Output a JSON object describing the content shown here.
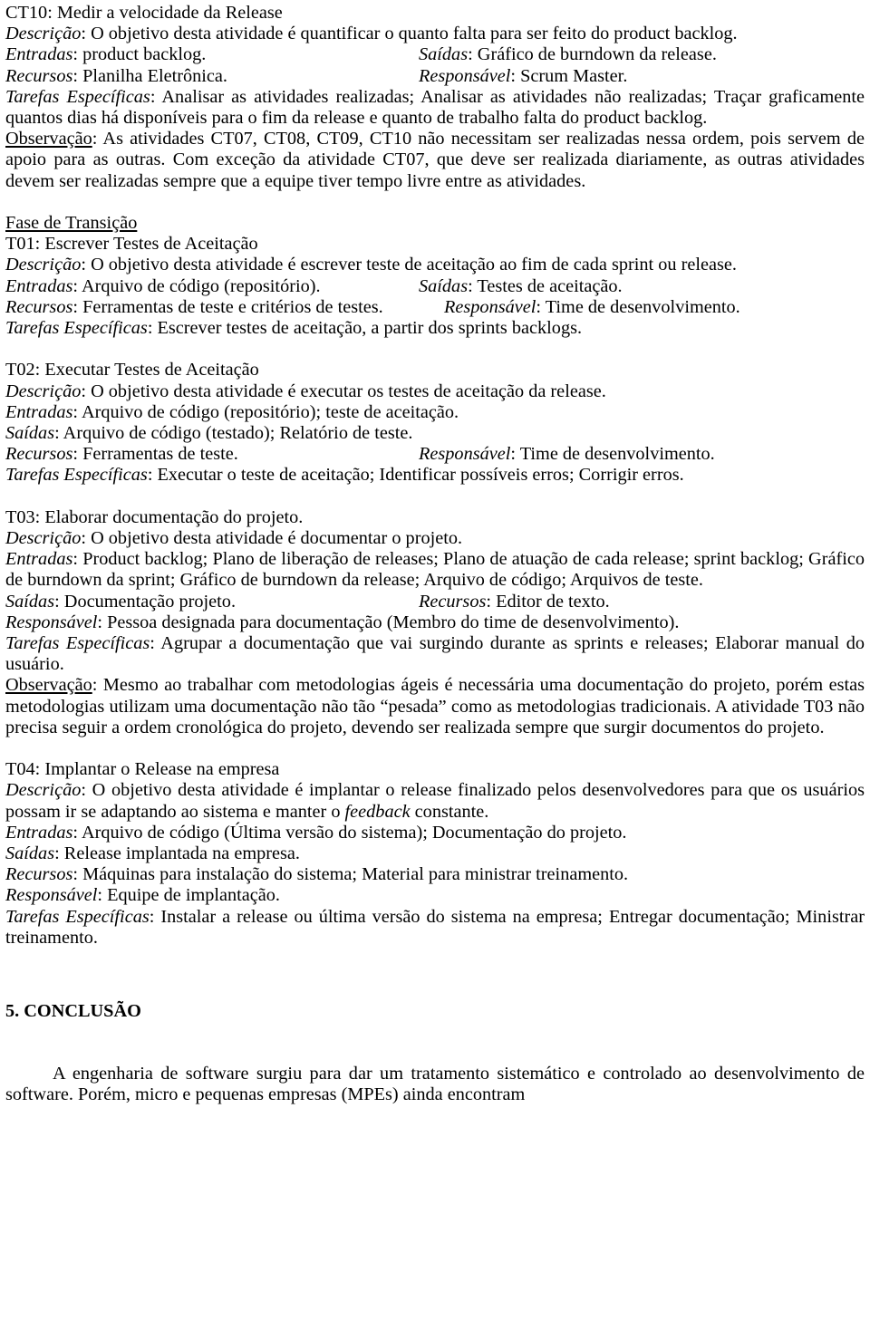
{
  "document": {
    "language": "pt-BR",
    "sections": [
      {
        "id": "ct10",
        "title": "CT10: Medir a velocidade da Release",
        "fields": {
          "descricao_label": "Descrição",
          "descricao_value": ": O objetivo desta atividade é quantificar o quanto falta para ser feito do product backlog.",
          "entradas_label": "Entradas",
          "entradas_value": ": product backlog.",
          "saidas_label": "Saídas",
          "saidas_value": ": Gráfico de burndown da release.",
          "recursos_label": "Recursos",
          "recursos_value": ": Planilha Eletrônica.",
          "responsavel_label": "Responsável",
          "responsavel_value": ": Scrum Master.",
          "tarefas_label": "Tarefas Específicas",
          "tarefas_value": ": Analisar as atividades realizadas; Analisar as atividades não realizadas; Traçar graficamente quantos dias há disponíveis para o fim da release e quanto de trabalho falta do product backlog.",
          "observacao_label": "Observação",
          "observacao_value": ": As atividades CT07, CT08, CT09, CT10 não necessitam ser realizadas nessa ordem, pois servem de apoio para as outras. Com exceção da atividade CT07, que deve ser realizada diariamente, as outras atividades devem ser realizadas sempre que a equipe tiver tempo livre entre as atividades."
        }
      },
      {
        "id": "fase-transicao",
        "heading": "Fase de Transição"
      },
      {
        "id": "t01",
        "title": "T01: Escrever Testes de Aceitação",
        "fields": {
          "descricao_label": "Descrição",
          "descricao_value": ": O objetivo desta atividade é escrever teste de aceitação ao fim de cada sprint ou release.",
          "entradas_label": "Entradas",
          "entradas_value": ": Arquivo de código (repositório).",
          "saidas_label": "Saídas",
          "saidas_value": ": Testes de aceitação.",
          "recursos_label": "Recursos",
          "recursos_value": ": Ferramentas de teste e critérios de testes.",
          "responsavel_label": "Responsável",
          "responsavel_value": ": Time de desenvolvimento.",
          "tarefas_label": "Tarefas Específicas",
          "tarefas_value": ": Escrever testes de aceitação, a partir dos sprints backlogs."
        }
      },
      {
        "id": "t02",
        "title": "T02: Executar Testes de Aceitação",
        "fields": {
          "descricao_label": "Descrição",
          "descricao_value": ": O objetivo desta atividade é executar os testes de aceitação da release.",
          "entradas_label": "Entradas",
          "entradas_value": ": Arquivo de código (repositório); teste de aceitação.",
          "saidas_label": "Saídas",
          "saidas_value": ": Arquivo de código (testado); Relatório de teste.",
          "recursos_label": "Recursos",
          "recursos_value": ": Ferramentas de teste.",
          "responsavel_label": "Responsável",
          "responsavel_value": ": Time de desenvolvimento.",
          "tarefas_label": "Tarefas Específicas",
          "tarefas_value": ": Executar o teste de aceitação; Identificar possíveis erros; Corrigir erros."
        }
      },
      {
        "id": "t03",
        "title": "T03: Elaborar documentação do projeto.",
        "fields": {
          "descricao_label": "Descrição",
          "descricao_value": ": O objetivo desta atividade é documentar o projeto.",
          "entradas_label": "Entradas",
          "entradas_value": ": Product backlog; Plano de liberação de releases; Plano de atuação de cada release; sprint backlog; Gráfico de burndown da sprint; Gráfico de burndown da release; Arquivo de código; Arquivos de teste.",
          "saidas_label": "Saídas",
          "saidas_value": ": Documentação projeto.",
          "recursos_label": "Recursos",
          "recursos_value": ": Editor de texto.",
          "responsavel_label": "Responsável",
          "responsavel_value": ": Pessoa designada para documentação (Membro do time de desenvolvimento).",
          "tarefas_label": "Tarefas Específicas",
          "tarefas_value": ": Agrupar a documentação que vai surgindo durante as sprints e releases; Elaborar manual do usuário.",
          "observacao_label": "Observação",
          "observacao_value": ": Mesmo ao trabalhar com metodologias ágeis é necessária uma documentação do projeto, porém estas metodologias utilizam uma documentação não tão “pesada” como as metodologias tradicionais. A atividade T03 não precisa seguir a ordem cronológica do projeto, devendo ser realizada sempre que surgir documentos do projeto."
        }
      },
      {
        "id": "t04",
        "title": "T04: Implantar o Release na empresa",
        "fields": {
          "descricao_label": "Descrição",
          "descricao_value_part1": ": O objetivo desta atividade é implantar o release finalizado pelos desenvolvedores para que os usuários possam ir se adaptando ao sistema e manter o ",
          "descricao_emphasis": "feedback",
          "descricao_value_part2": " constante.",
          "entradas_label": "Entradas",
          "entradas_value": ": Arquivo de código (Última versão do sistema); Documentação do projeto.",
          "saidas_label": "Saídas",
          "saidas_value": ": Release implantada na empresa.",
          "recursos_label": "Recursos",
          "recursos_value": ": Máquinas para instalação do sistema; Material para ministrar treinamento.",
          "responsavel_label": "Responsável",
          "responsavel_value": ": Equipe de implantação.",
          "tarefas_label": "Tarefas Específicas",
          "tarefas_value": ": Instalar a release ou última versão do sistema na empresa; Entregar documentação; Ministrar treinamento."
        }
      },
      {
        "id": "conclusao",
        "heading": "5. CONCLUSÃO",
        "paragraph": "A engenharia de software surgiu para dar um tratamento sistemático e controlado ao desenvolvimento de software. Porém, micro e pequenas empresas (MPEs) ainda encontram"
      }
    ]
  }
}
